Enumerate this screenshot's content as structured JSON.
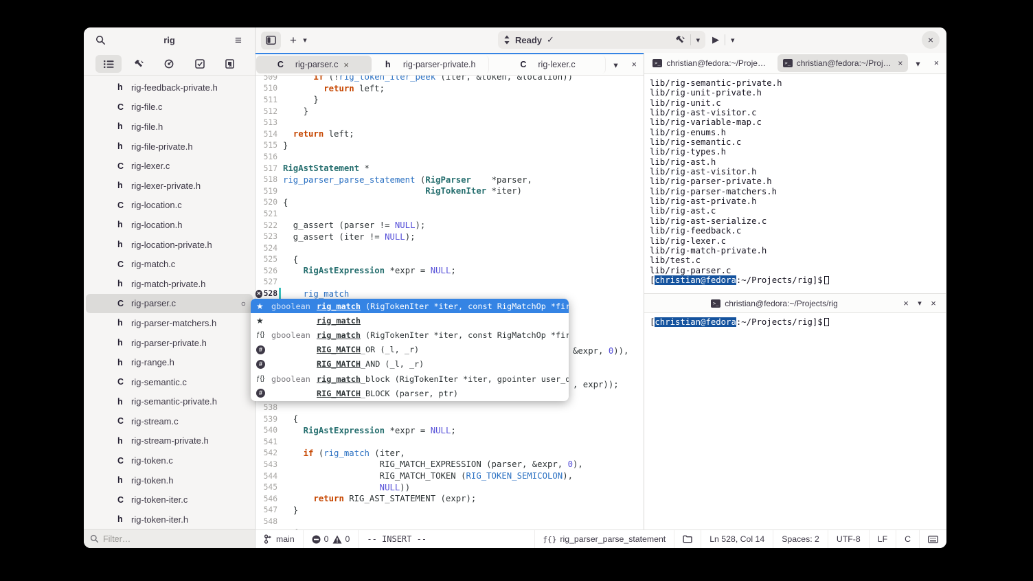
{
  "colors": {
    "accent": "#3584e4",
    "selection": "#3584e4",
    "keyword": "#c64600",
    "type": "#256e6e",
    "function": "#2a70c2",
    "constant": "#554fd8",
    "change_bar": "#3cc0ba",
    "prompt_highlight": "#15539e"
  },
  "icons": {
    "menu": "≡",
    "plus": "+",
    "chevron_down": "▾",
    "check": "✓",
    "play": "▶",
    "close": "×",
    "star": "★",
    "func_glyph": "ƒ{}",
    "hash": "#",
    "modified_ring": "○",
    "error_x": "✕",
    "terminal_glyph": ">_"
  },
  "sidebar": {
    "title": "rig",
    "panel_tabs": [
      "project-tree",
      "build",
      "diagnostics",
      "todo",
      "bookmarks"
    ],
    "filter_placeholder": "Filter…",
    "files": [
      {
        "kind": "h",
        "name": "rig-feedback-private.h"
      },
      {
        "kind": "C",
        "name": "rig-file.c"
      },
      {
        "kind": "h",
        "name": "rig-file.h"
      },
      {
        "kind": "h",
        "name": "rig-file-private.h"
      },
      {
        "kind": "C",
        "name": "rig-lexer.c"
      },
      {
        "kind": "h",
        "name": "rig-lexer-private.h"
      },
      {
        "kind": "C",
        "name": "rig-location.c"
      },
      {
        "kind": "h",
        "name": "rig-location.h"
      },
      {
        "kind": "h",
        "name": "rig-location-private.h"
      },
      {
        "kind": "C",
        "name": "rig-match.c"
      },
      {
        "kind": "h",
        "name": "rig-match-private.h"
      },
      {
        "kind": "C",
        "name": "rig-parser.c",
        "selected": true,
        "modified": true
      },
      {
        "kind": "h",
        "name": "rig-parser-matchers.h"
      },
      {
        "kind": "h",
        "name": "rig-parser-private.h"
      },
      {
        "kind": "h",
        "name": "rig-range.h"
      },
      {
        "kind": "C",
        "name": "rig-semantic.c"
      },
      {
        "kind": "h",
        "name": "rig-semantic-private.h"
      },
      {
        "kind": "C",
        "name": "rig-stream.c"
      },
      {
        "kind": "h",
        "name": "rig-stream-private.h"
      },
      {
        "kind": "C",
        "name": "rig-token.c"
      },
      {
        "kind": "h",
        "name": "rig-token.h"
      },
      {
        "kind": "C",
        "name": "rig-token-iter.c"
      },
      {
        "kind": "h",
        "name": "rig-token-iter.h"
      }
    ]
  },
  "header": {
    "omnibar_status": "Ready"
  },
  "editor": {
    "tabs": [
      {
        "kind": "C",
        "label": "rig-parser.c",
        "selected": true,
        "close": true
      },
      {
        "kind": "h",
        "label": "rig-parser-private.h",
        "selected": false,
        "close": false
      },
      {
        "kind": "C",
        "label": "rig-lexer.c",
        "selected": false,
        "close": false
      }
    ],
    "lines": [
      {
        "n": 509,
        "segs": [
          [
            "p",
            "      "
          ],
          [
            "k",
            "if"
          ],
          [
            "p",
            " (!"
          ],
          [
            "f",
            "rig_token_iter_peek"
          ],
          [
            "p",
            " (iter, &token, &location))"
          ]
        ]
      },
      {
        "n": 510,
        "segs": [
          [
            "p",
            "        "
          ],
          [
            "k",
            "return"
          ],
          [
            "p",
            " left;"
          ]
        ]
      },
      {
        "n": 511,
        "segs": [
          [
            "p",
            "      }"
          ]
        ]
      },
      {
        "n": 512,
        "segs": [
          [
            "p",
            "    }"
          ]
        ]
      },
      {
        "n": 513,
        "segs": []
      },
      {
        "n": 514,
        "segs": [
          [
            "p",
            "  "
          ],
          [
            "k",
            "return"
          ],
          [
            "p",
            " left;"
          ]
        ]
      },
      {
        "n": 515,
        "segs": [
          [
            "p",
            "}"
          ]
        ]
      },
      {
        "n": 516,
        "segs": []
      },
      {
        "n": 517,
        "segs": [
          [
            "t",
            "RigAstStatement"
          ],
          [
            "p",
            " *"
          ]
        ]
      },
      {
        "n": 518,
        "segs": [
          [
            "f",
            "rig_parser_parse_statement"
          ],
          [
            "p",
            " ("
          ],
          [
            "t",
            "RigParser"
          ],
          [
            "p",
            "    *parser,"
          ]
        ]
      },
      {
        "n": 519,
        "segs": [
          [
            "p",
            "                            "
          ],
          [
            "t",
            "RigTokenIter"
          ],
          [
            "p",
            " *iter)"
          ]
        ]
      },
      {
        "n": 520,
        "segs": [
          [
            "p",
            "{"
          ]
        ]
      },
      {
        "n": 521,
        "segs": []
      },
      {
        "n": 522,
        "segs": [
          [
            "p",
            "  g_assert (parser != "
          ],
          [
            "c",
            "NULL"
          ],
          [
            "p",
            ");"
          ]
        ]
      },
      {
        "n": 523,
        "segs": [
          [
            "p",
            "  g_assert (iter != "
          ],
          [
            "c",
            "NULL"
          ],
          [
            "p",
            ");"
          ]
        ]
      },
      {
        "n": 524,
        "segs": []
      },
      {
        "n": 525,
        "segs": [
          [
            "p",
            "  {"
          ]
        ]
      },
      {
        "n": 526,
        "segs": [
          [
            "p",
            "    "
          ],
          [
            "t",
            "RigAstExpression"
          ],
          [
            "p",
            " *expr = "
          ],
          [
            "c",
            "NULL"
          ],
          [
            "p",
            ";"
          ]
        ]
      },
      {
        "n": 527,
        "segs": []
      },
      {
        "n": 528,
        "segs": [
          [
            "p",
            "    "
          ],
          [
            "e",
            "rig_match"
          ]
        ],
        "error": true,
        "changed": true
      },
      {
        "n": 529,
        "segs": []
      },
      {
        "n": 530,
        "segs": []
      },
      {
        "n": 531,
        "segs": []
      },
      {
        "n": 532,
        "segs": []
      },
      {
        "n": 533,
        "segs": [
          [
            "p",
            "                                                         &expr, "
          ],
          [
            "c",
            "0"
          ],
          [
            "p",
            ")),"
          ]
        ]
      },
      {
        "n": 534,
        "segs": []
      },
      {
        "n": 535,
        "segs": []
      },
      {
        "n": 536,
        "segs": [
          [
            "p",
            "                                                         , expr));"
          ]
        ]
      },
      {
        "n": 537,
        "segs": []
      },
      {
        "n": 538,
        "segs": []
      },
      {
        "n": 539,
        "segs": [
          [
            "p",
            "  {"
          ]
        ]
      },
      {
        "n": 540,
        "segs": [
          [
            "p",
            "    "
          ],
          [
            "t",
            "RigAstExpression"
          ],
          [
            "p",
            " *expr = "
          ],
          [
            "c",
            "NULL"
          ],
          [
            "p",
            ";"
          ]
        ]
      },
      {
        "n": 541,
        "segs": []
      },
      {
        "n": 542,
        "segs": [
          [
            "p",
            "    "
          ],
          [
            "k",
            "if"
          ],
          [
            "p",
            " ("
          ],
          [
            "f",
            "rig_match"
          ],
          [
            "p",
            " (iter,"
          ]
        ]
      },
      {
        "n": 543,
        "segs": [
          [
            "p",
            "                   RIG_MATCH_EXPRESSION (parser, &expr, "
          ],
          [
            "c",
            "0"
          ],
          [
            "p",
            "),"
          ]
        ]
      },
      {
        "n": 544,
        "segs": [
          [
            "p",
            "                   RIG_MATCH_TOKEN ("
          ],
          [
            "f",
            "RIG_TOKEN_SEMICOLON"
          ],
          [
            "p",
            "),"
          ]
        ]
      },
      {
        "n": 545,
        "segs": [
          [
            "p",
            "                   "
          ],
          [
            "c",
            "NULL"
          ],
          [
            "p",
            "))"
          ]
        ]
      },
      {
        "n": 546,
        "segs": [
          [
            "p",
            "      "
          ],
          [
            "k",
            "return"
          ],
          [
            "p",
            " RIG_AST_STATEMENT (expr);"
          ]
        ]
      },
      {
        "n": 547,
        "segs": [
          [
            "p",
            "  }"
          ]
        ]
      },
      {
        "n": 548,
        "segs": []
      },
      {
        "n": 549,
        "segs": [
          [
            "p",
            "  {"
          ]
        ]
      }
    ]
  },
  "completion": {
    "rows": [
      {
        "icon": "star",
        "selected": true,
        "ret": "gboolean",
        "name": "rig_match",
        "rest": " (RigTokenIter *iter, const RigMatchOp *first_op, ...)"
      },
      {
        "icon": "star",
        "selected": false,
        "ret": "",
        "name": "rig_match",
        "rest": ""
      },
      {
        "icon": "func",
        "selected": false,
        "ret": "gboolean",
        "name": "rig_match",
        "rest": " (RigTokenIter *iter, const RigMatchOp *first_op, ...)"
      },
      {
        "icon": "macro",
        "selected": false,
        "ret": "",
        "name": "RIG_MATCH",
        "rest": "_OR (_l, _r)"
      },
      {
        "icon": "macro",
        "selected": false,
        "ret": "",
        "name": "RIG_MATCH",
        "rest": "_AND (_l, _r)"
      },
      {
        "icon": "func",
        "selected": false,
        "ret": "gboolean",
        "name": "rig_match",
        "rest": "_block (RigTokenIter *iter, gpointer user_data)"
      },
      {
        "icon": "macro",
        "selected": false,
        "ret": "",
        "name": "RIG_MATCH",
        "rest": "_BLOCK (parser, ptr)"
      }
    ]
  },
  "terminal": {
    "tabs": [
      {
        "label": "christian@fedora:~/Projects/rig",
        "selected": false,
        "close": false
      },
      {
        "label": "christian@fedora:~/Projects",
        "selected": true,
        "close": true
      }
    ],
    "pane2_title": "christian@fedora:~/Projects/rig",
    "output_lines": [
      "lib/rig-semantic-private.h",
      "lib/rig-unit-private.h",
      "lib/rig-unit.c",
      "lib/rig-ast-visitor.c",
      "lib/rig-variable-map.c",
      "lib/rig-enums.h",
      "lib/rig-semantic.c",
      "lib/rig-types.h",
      "lib/rig-ast.h",
      "lib/rig-ast-visitor.h",
      "lib/rig-parser-private.h",
      "lib/rig-parser-matchers.h",
      "lib/rig-ast-private.h",
      "lib/rig-ast.c",
      "lib/rig-ast-serialize.c",
      "lib/rig-feedback.c",
      "lib/rig-lexer.c",
      "lib/rig-match-private.h",
      "lib/test.c",
      "lib/rig-parser.c"
    ],
    "prompt": {
      "open": "[",
      "user": "christian@fedora",
      "rest": ":~/Projects/rig]$"
    }
  },
  "statusbar": {
    "branch": "main",
    "errors": "0",
    "warnings": "0",
    "mode": "-- INSERT --",
    "symbol": "rig_parser_parse_statement",
    "position": "Ln 528, Col 14",
    "spaces": "Spaces: 2",
    "encoding": "UTF-8",
    "line_ending": "LF",
    "language": "C"
  }
}
